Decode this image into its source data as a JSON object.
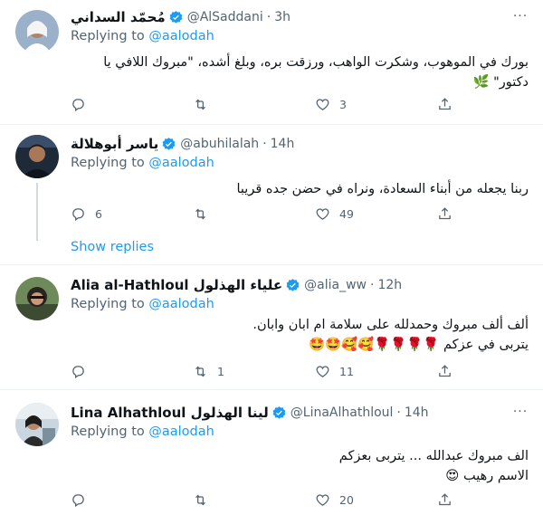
{
  "tweets": [
    {
      "name": "مُحمّد السداني",
      "handle": "@AlSaddani",
      "time": "3h",
      "replying_prefix": "Replying to ",
      "replying_to": "@aalodah",
      "text_line1": "بورك في الموهوب، وشكرت الواهب، ورزقت بره، وبلغ أشده، \"مبروك اللافي يا",
      "text_line2": "دكتور\" 🌿",
      "replies": "",
      "retweets": "",
      "likes": "3",
      "avatar_bg": "#9bb1c9"
    },
    {
      "name": "ياسر أبوهلالة",
      "handle": "@abuhilalah",
      "time": "14h",
      "replying_prefix": "Replying to ",
      "replying_to": "@aalodah",
      "text_line1": "ربنا يجعله من أبناء السعادة، ونراه في حضن جده قريبا",
      "replies": "6",
      "retweets": "",
      "likes": "49",
      "avatar_bg": "#1f2a38"
    },
    {
      "name": "Alia al-Hathloul علياء الهذلول",
      "handle": "@alia_ww",
      "time": "12h",
      "replying_prefix": "Replying to ",
      "replying_to": "@aalodah",
      "text_line1": "ألف ألف مبروك وحمدلله على سلامة ام ابان وابان.",
      "text_line2": "يتربى في عزكم 🌹🌹🌹🌹🥰🥰🤩🤩",
      "replies": "",
      "retweets": "1",
      "likes": "11",
      "avatar_bg": "#6f8a5a"
    },
    {
      "name": "Lina Alhathloul لينا الهذلول",
      "handle": "@LinaAlhathloul",
      "time": "14h",
      "replying_prefix": "Replying to ",
      "replying_to": "@aalodah",
      "text_line1": "الف مبروك عبدالله ... يتربى بعزكم",
      "text_line2": "الاسم رهيب 😍",
      "replies": "",
      "retweets": "",
      "likes": "20",
      "avatar_bg": "#c9d6df"
    }
  ],
  "show_replies": "Show replies",
  "separator": "·",
  "more_glyph": "···",
  "colors": {
    "accent": "#1d9bf0",
    "muted": "#536471",
    "verified": "#1d9bf0"
  }
}
